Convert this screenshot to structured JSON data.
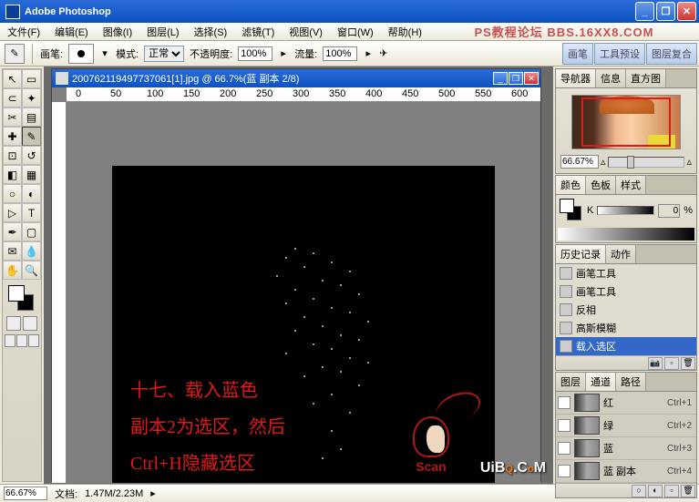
{
  "app": {
    "title": "Adobe Photoshop",
    "watermark": "PS教程论坛  BBS.16XX8.COM"
  },
  "menu": [
    "文件(F)",
    "编辑(E)",
    "图像(I)",
    "图层(L)",
    "选择(S)",
    "滤镜(T)",
    "视图(V)",
    "窗口(W)",
    "帮助(H)"
  ],
  "options": {
    "brush_label": "画笔:",
    "mode_label": "模式:",
    "mode_value": "正常",
    "opacity_label": "不透明度:",
    "opacity_value": "100%",
    "flow_label": "流量:",
    "flow_value": "100%",
    "dock": [
      "画笔",
      "工具预设",
      "图层复合"
    ]
  },
  "document": {
    "title": "200762119497737061[1].jpg @ 66.7%(蓝 副本 2/8)",
    "annotations": {
      "line1": "十七、载入蓝色",
      "line2": "副本2为选区，然后",
      "line3": "Ctrl+H隐藏选区"
    },
    "scan_label": "Scan"
  },
  "ruler_marks": [
    "0",
    "50",
    "100",
    "150",
    "200",
    "250",
    "300",
    "350",
    "400",
    "450",
    "500",
    "550",
    "600"
  ],
  "panels": {
    "navigator": {
      "tabs": [
        "导航器",
        "信息",
        "直方图"
      ],
      "zoom": "66.67%"
    },
    "color": {
      "tabs": [
        "颜色",
        "色板",
        "样式"
      ],
      "k_label": "K",
      "k_value": "0",
      "pct": "%"
    },
    "history": {
      "tabs": [
        "历史记录",
        "动作"
      ],
      "items": [
        {
          "label": "画笔工具",
          "active": false
        },
        {
          "label": "画笔工具",
          "active": false
        },
        {
          "label": "反相",
          "active": false
        },
        {
          "label": "高斯模糊",
          "active": false
        },
        {
          "label": "载入选区",
          "active": true
        }
      ]
    },
    "channels": {
      "tabs": [
        "图层",
        "通道",
        "路径"
      ],
      "items": [
        {
          "label": "红",
          "shortcut": "Ctrl+1"
        },
        {
          "label": "绿",
          "shortcut": "Ctrl+2"
        },
        {
          "label": "蓝",
          "shortcut": "Ctrl+3"
        },
        {
          "label": "蓝 副本",
          "shortcut": "Ctrl+4"
        }
      ]
    }
  },
  "status": {
    "zoom": "66.67%",
    "docsize_label": "文档:",
    "docsize": "1.47M/2.23M"
  },
  "watermark2": "UiBQ.CoM"
}
